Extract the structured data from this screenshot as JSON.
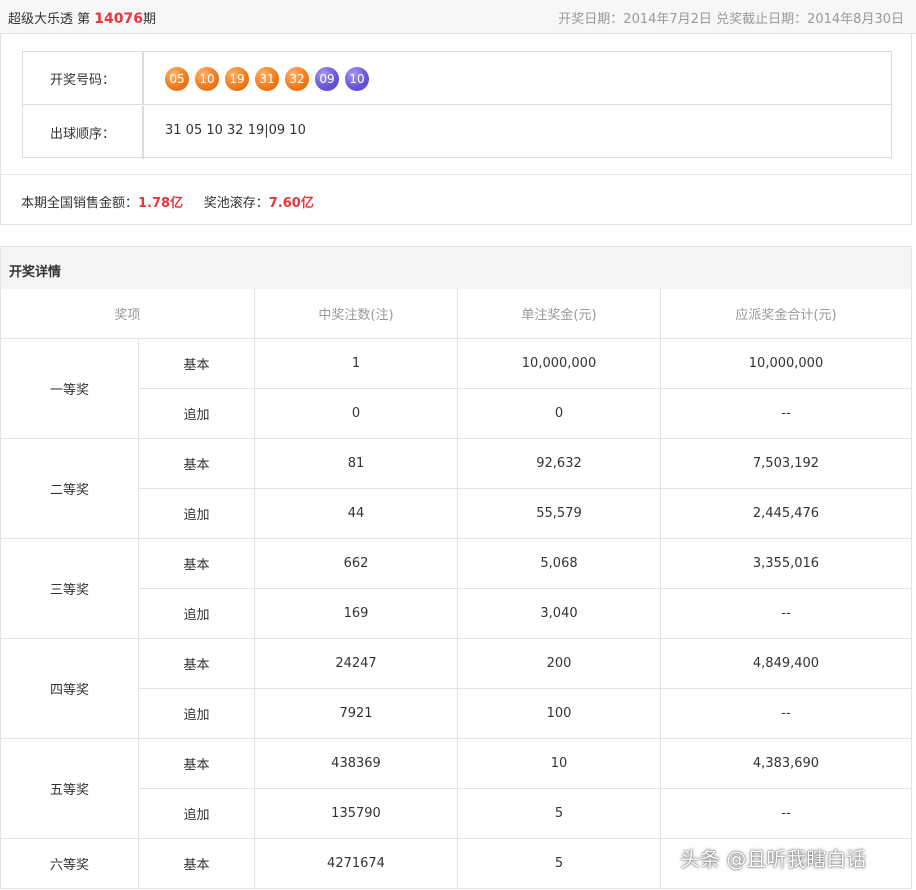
{
  "header": {
    "lottery_name": "超级大乐透 第",
    "issue_number": "14076",
    "issue_suffix": "期",
    "draw_date_label": "开奖日期：",
    "draw_date": "2014年7月2日",
    "deadline_label": "兑奖截止日期：",
    "deadline_date": "2014年8月30日"
  },
  "draw": {
    "numbers_label": "开奖号码：",
    "red_balls": [
      "05",
      "10",
      "19",
      "31",
      "32"
    ],
    "blue_balls": [
      "09",
      "10"
    ],
    "order_label": "出球顺序：",
    "order_value": "31 05 10 32 19|09 10"
  },
  "colors": {
    "accent_red": "#e4393c",
    "red_ball": "#f07c1e",
    "blue_ball": "#6c56d8"
  },
  "sales": {
    "sales_label": "本期全国销售金额：",
    "sales_value": "1.78亿",
    "pool_label": "奖池滚存：",
    "pool_value": "7.60亿"
  },
  "details": {
    "section_title": "开奖详情",
    "columns": [
      "奖项",
      "中奖注数(注)",
      "单注奖金(元)",
      "应派奖金合计(元)"
    ],
    "prizes": [
      {
        "name": "一等奖",
        "rows": [
          {
            "type": "基本",
            "count": "1",
            "amount": "10,000,000",
            "total": "10,000,000"
          },
          {
            "type": "追加",
            "count": "0",
            "amount": "0",
            "total": "--"
          }
        ]
      },
      {
        "name": "二等奖",
        "rows": [
          {
            "type": "基本",
            "count": "81",
            "amount": "92,632",
            "total": "7,503,192"
          },
          {
            "type": "追加",
            "count": "44",
            "amount": "55,579",
            "total": "2,445,476"
          }
        ]
      },
      {
        "name": "三等奖",
        "rows": [
          {
            "type": "基本",
            "count": "662",
            "amount": "5,068",
            "total": "3,355,016"
          },
          {
            "type": "追加",
            "count": "169",
            "amount": "3,040",
            "total": "--"
          }
        ]
      },
      {
        "name": "四等奖",
        "rows": [
          {
            "type": "基本",
            "count": "24247",
            "amount": "200",
            "total": "4,849,400"
          },
          {
            "type": "追加",
            "count": "7921",
            "amount": "100",
            "total": "--"
          }
        ]
      },
      {
        "name": "五等奖",
        "rows": [
          {
            "type": "基本",
            "count": "438369",
            "amount": "10",
            "total": "4,383,690"
          },
          {
            "type": "追加",
            "count": "135790",
            "amount": "5",
            "total": "--"
          }
        ]
      },
      {
        "name": "六等奖",
        "rows": [
          {
            "type": "基本",
            "count": "4271674",
            "amount": "5",
            "total": ""
          }
        ]
      }
    ]
  },
  "watermark": "头条 @且听我瞎白话"
}
